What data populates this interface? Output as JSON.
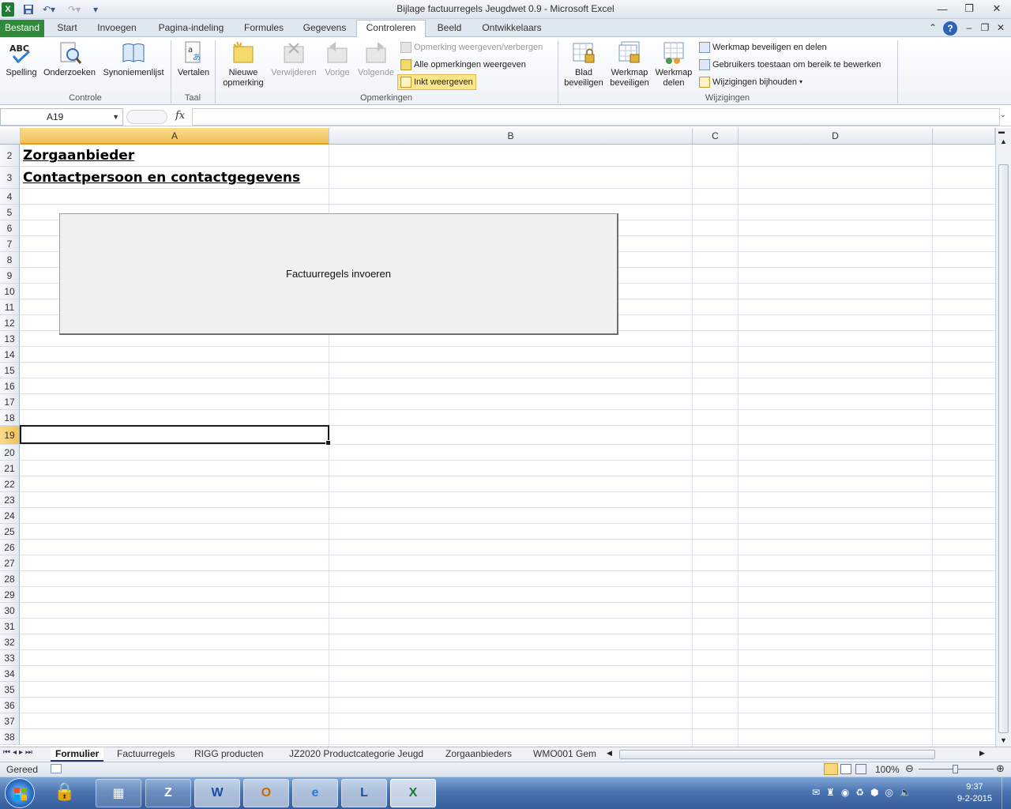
{
  "window": {
    "title": "Bijlage factuurregels Jeugdwet 0.9  -  Microsoft Excel"
  },
  "ribbon": {
    "tabs": [
      "Bestand",
      "Start",
      "Invoegen",
      "Pagina-indeling",
      "Formules",
      "Gegevens",
      "Controleren",
      "Beeld",
      "Ontwikkelaars"
    ],
    "active_tab": "Controleren",
    "groups": {
      "controle": {
        "label": "Controle",
        "spelling": "Spelling",
        "onderzoeken": "Onderzoeken",
        "synoniemenlijst": "Synoniemenlijst"
      },
      "taal": {
        "label": "Taal",
        "vertalen": "Vertalen"
      },
      "opmerkingen": {
        "label": "Opmerkingen",
        "nieuwe_1": "Nieuwe",
        "nieuwe_2": "opmerking",
        "verwijderen": "Verwijderen",
        "vorige": "Vorige",
        "volgende": "Volgende",
        "weergeven_verbergen": "Opmerking weergeven/verbergen",
        "alle_weergeven": "Alle opmerkingen weergeven",
        "inkt_weergeven": "Inkt weergeven"
      },
      "wijzigingen": {
        "label": "Wijzigingen",
        "blad_1": "Blad",
        "blad_2": "beveiligen",
        "werkmap_bev_1": "Werkmap",
        "werkmap_bev_2": "beveiligen",
        "werkmap_del_1": "Werkmap",
        "werkmap_del_2": "delen",
        "beveiligen_delen": "Werkmap beveiligen en delen",
        "gebruikers_toestaan": "Gebruikers toestaan om bereik te bewerken",
        "wijzigingen_bijhouden": "Wijzigingen bijhouden"
      }
    }
  },
  "formula_bar": {
    "name_box": "A19",
    "fx": "fx",
    "formula": ""
  },
  "sheet": {
    "columns": [
      "A",
      "B",
      "C",
      "D"
    ],
    "selected_column": "A",
    "rows": [
      "2",
      "3",
      "4",
      "5",
      "6",
      "7",
      "8",
      "9",
      "10",
      "11",
      "12",
      "13",
      "14",
      "15",
      "16",
      "17",
      "18",
      "19",
      "20",
      "21",
      "22",
      "23",
      "24",
      "25",
      "26",
      "27",
      "28",
      "29",
      "30",
      "31",
      "32",
      "33",
      "34",
      "35",
      "36",
      "37",
      "38"
    ],
    "selected_row": "19",
    "cell_A2": "Zorgaanbieder",
    "cell_A3": "Contactpersoon en contactgegevens",
    "form_button": "Factuurregels invoeren"
  },
  "sheet_tabs": [
    "Formulier",
    "Factuurregels",
    "RIGG producten",
    "JZ2020 Productcategorie Jeugd",
    "Zorgaanbieders",
    "WMO001 Gem"
  ],
  "active_sheet": "Formulier",
  "status": {
    "text": "Gereed",
    "zoom": "100%"
  },
  "taskbar": {
    "time": "9:37",
    "date": "9-2-2015"
  },
  "colors": {
    "file_tab": "#2f8b3a",
    "selection_header": "#f1c15a",
    "taskbar": "#4c74b0"
  }
}
